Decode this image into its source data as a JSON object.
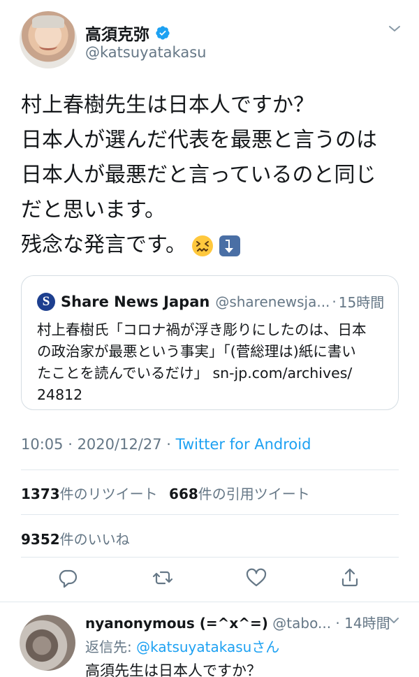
{
  "tweet": {
    "author": {
      "display_name": "高須克弥",
      "handle": "@katsuyatakasu",
      "verified": true
    },
    "text_lines": [
      "村上春樹先生は日本人ですか？",
      "日本人が選んだ代表を最悪と言うのは",
      "日本人が最悪だと言っているのと同じ",
      "だと思います。",
      "残念な発言です。"
    ],
    "emojis": [
      "confounded-face",
      "arrow-down-right"
    ],
    "quoted": {
      "logo_letter": "S",
      "name": "Share News Japan",
      "handle": "@sharenewsja...",
      "separator": "·",
      "time": "15時間",
      "text_lines": [
        "村上春樹氏「コロナ禍が浮き彫りにしたのは、日本",
        "の政治家が最悪という事実」「(菅総理は)紙に書い",
        "たことを読んでいるだけ」 sn-jp.com/archives/",
        "24812"
      ]
    },
    "meta": {
      "time": "10:05",
      "sep1": " · ",
      "date": "2020/12/27",
      "sep2": " · ",
      "source": "Twitter for Android"
    },
    "stats": {
      "retweets_count": "1373",
      "retweets_label": "件のリツイート",
      "quotes_count": "668",
      "quotes_label": "件の引用ツイート",
      "likes_count": "9352",
      "likes_label": "件のいいね"
    },
    "actions": [
      "reply-icon",
      "retweet-icon",
      "like-icon",
      "share-icon"
    ]
  },
  "reply": {
    "display_name": "nyanonymous (=^x^=)",
    "handle": "@tabo...",
    "time": "14時間",
    "reply_to_prefix": "返信先: ",
    "reply_to_mention": "@katsuyatakasuさん",
    "text": "高須先生は日本人ですか？"
  },
  "colors": {
    "accent": "#1da1f2",
    "text": "#14171a",
    "secondary": "#657786",
    "divider": "#e1e8ed"
  }
}
